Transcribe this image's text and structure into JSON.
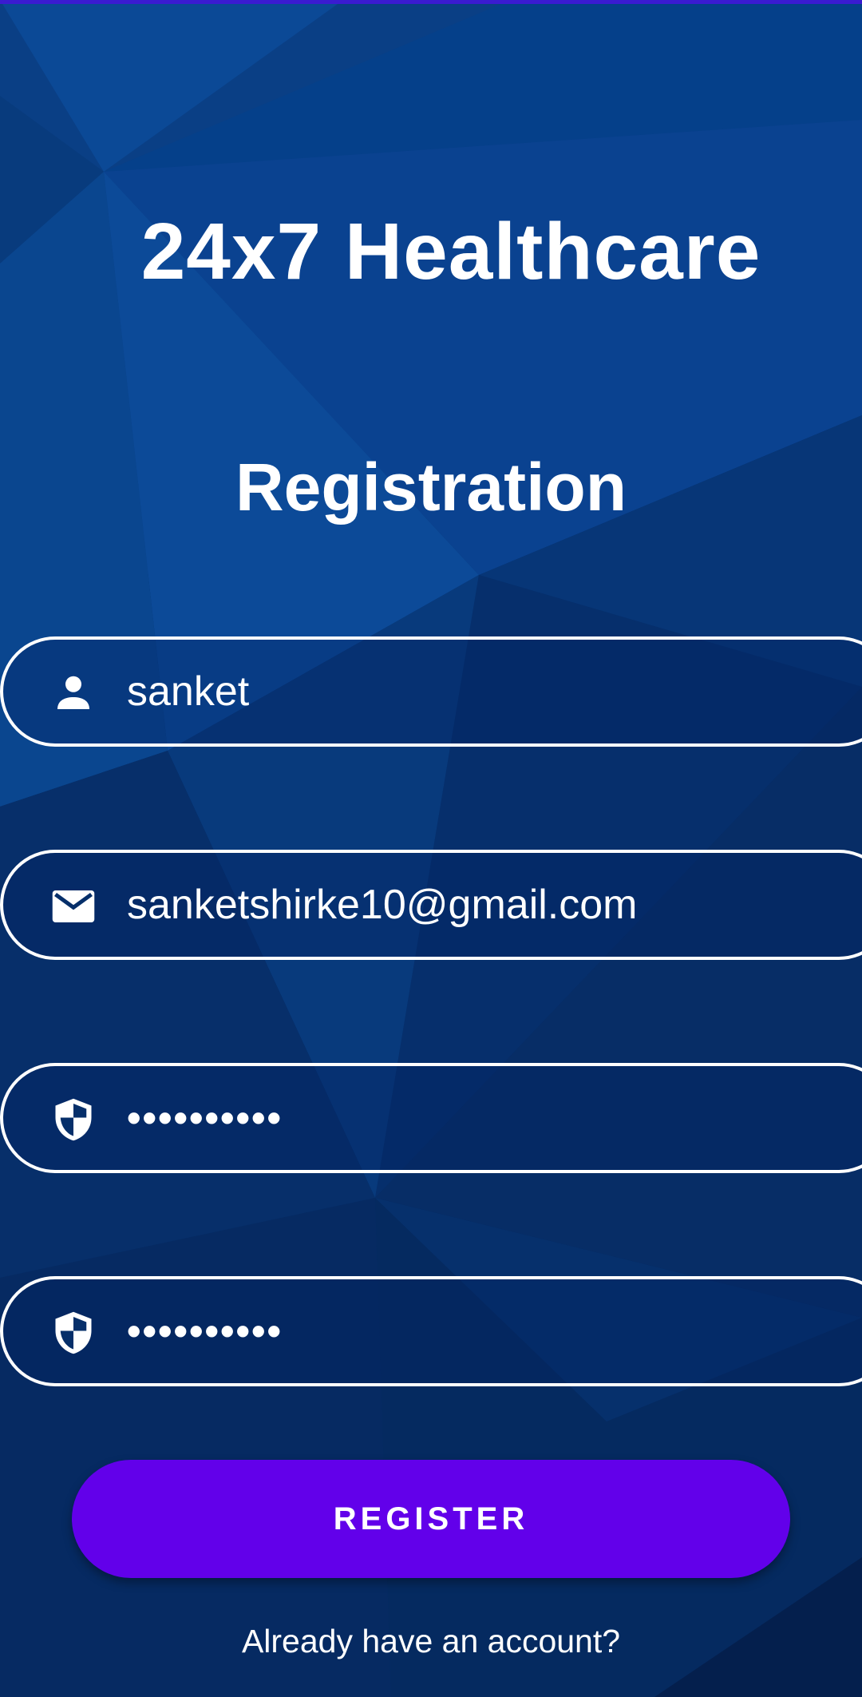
{
  "app": {
    "title": "24x7 Healthcare",
    "subtitle": "Registration"
  },
  "form": {
    "username": {
      "value": "sanket",
      "icon": "person-icon"
    },
    "email": {
      "value": "sanketshirke10@gmail.com",
      "icon": "email-icon"
    },
    "password": {
      "value": "••••••••••",
      "icon": "shield-icon"
    },
    "confirm_password": {
      "value": "••••••••••",
      "icon": "shield-icon"
    }
  },
  "actions": {
    "register_label": "REGISTER",
    "login_link": "Already have an account?"
  },
  "colors": {
    "background": "#062f6a",
    "accent": "#6200ea",
    "text": "#ffffff"
  }
}
